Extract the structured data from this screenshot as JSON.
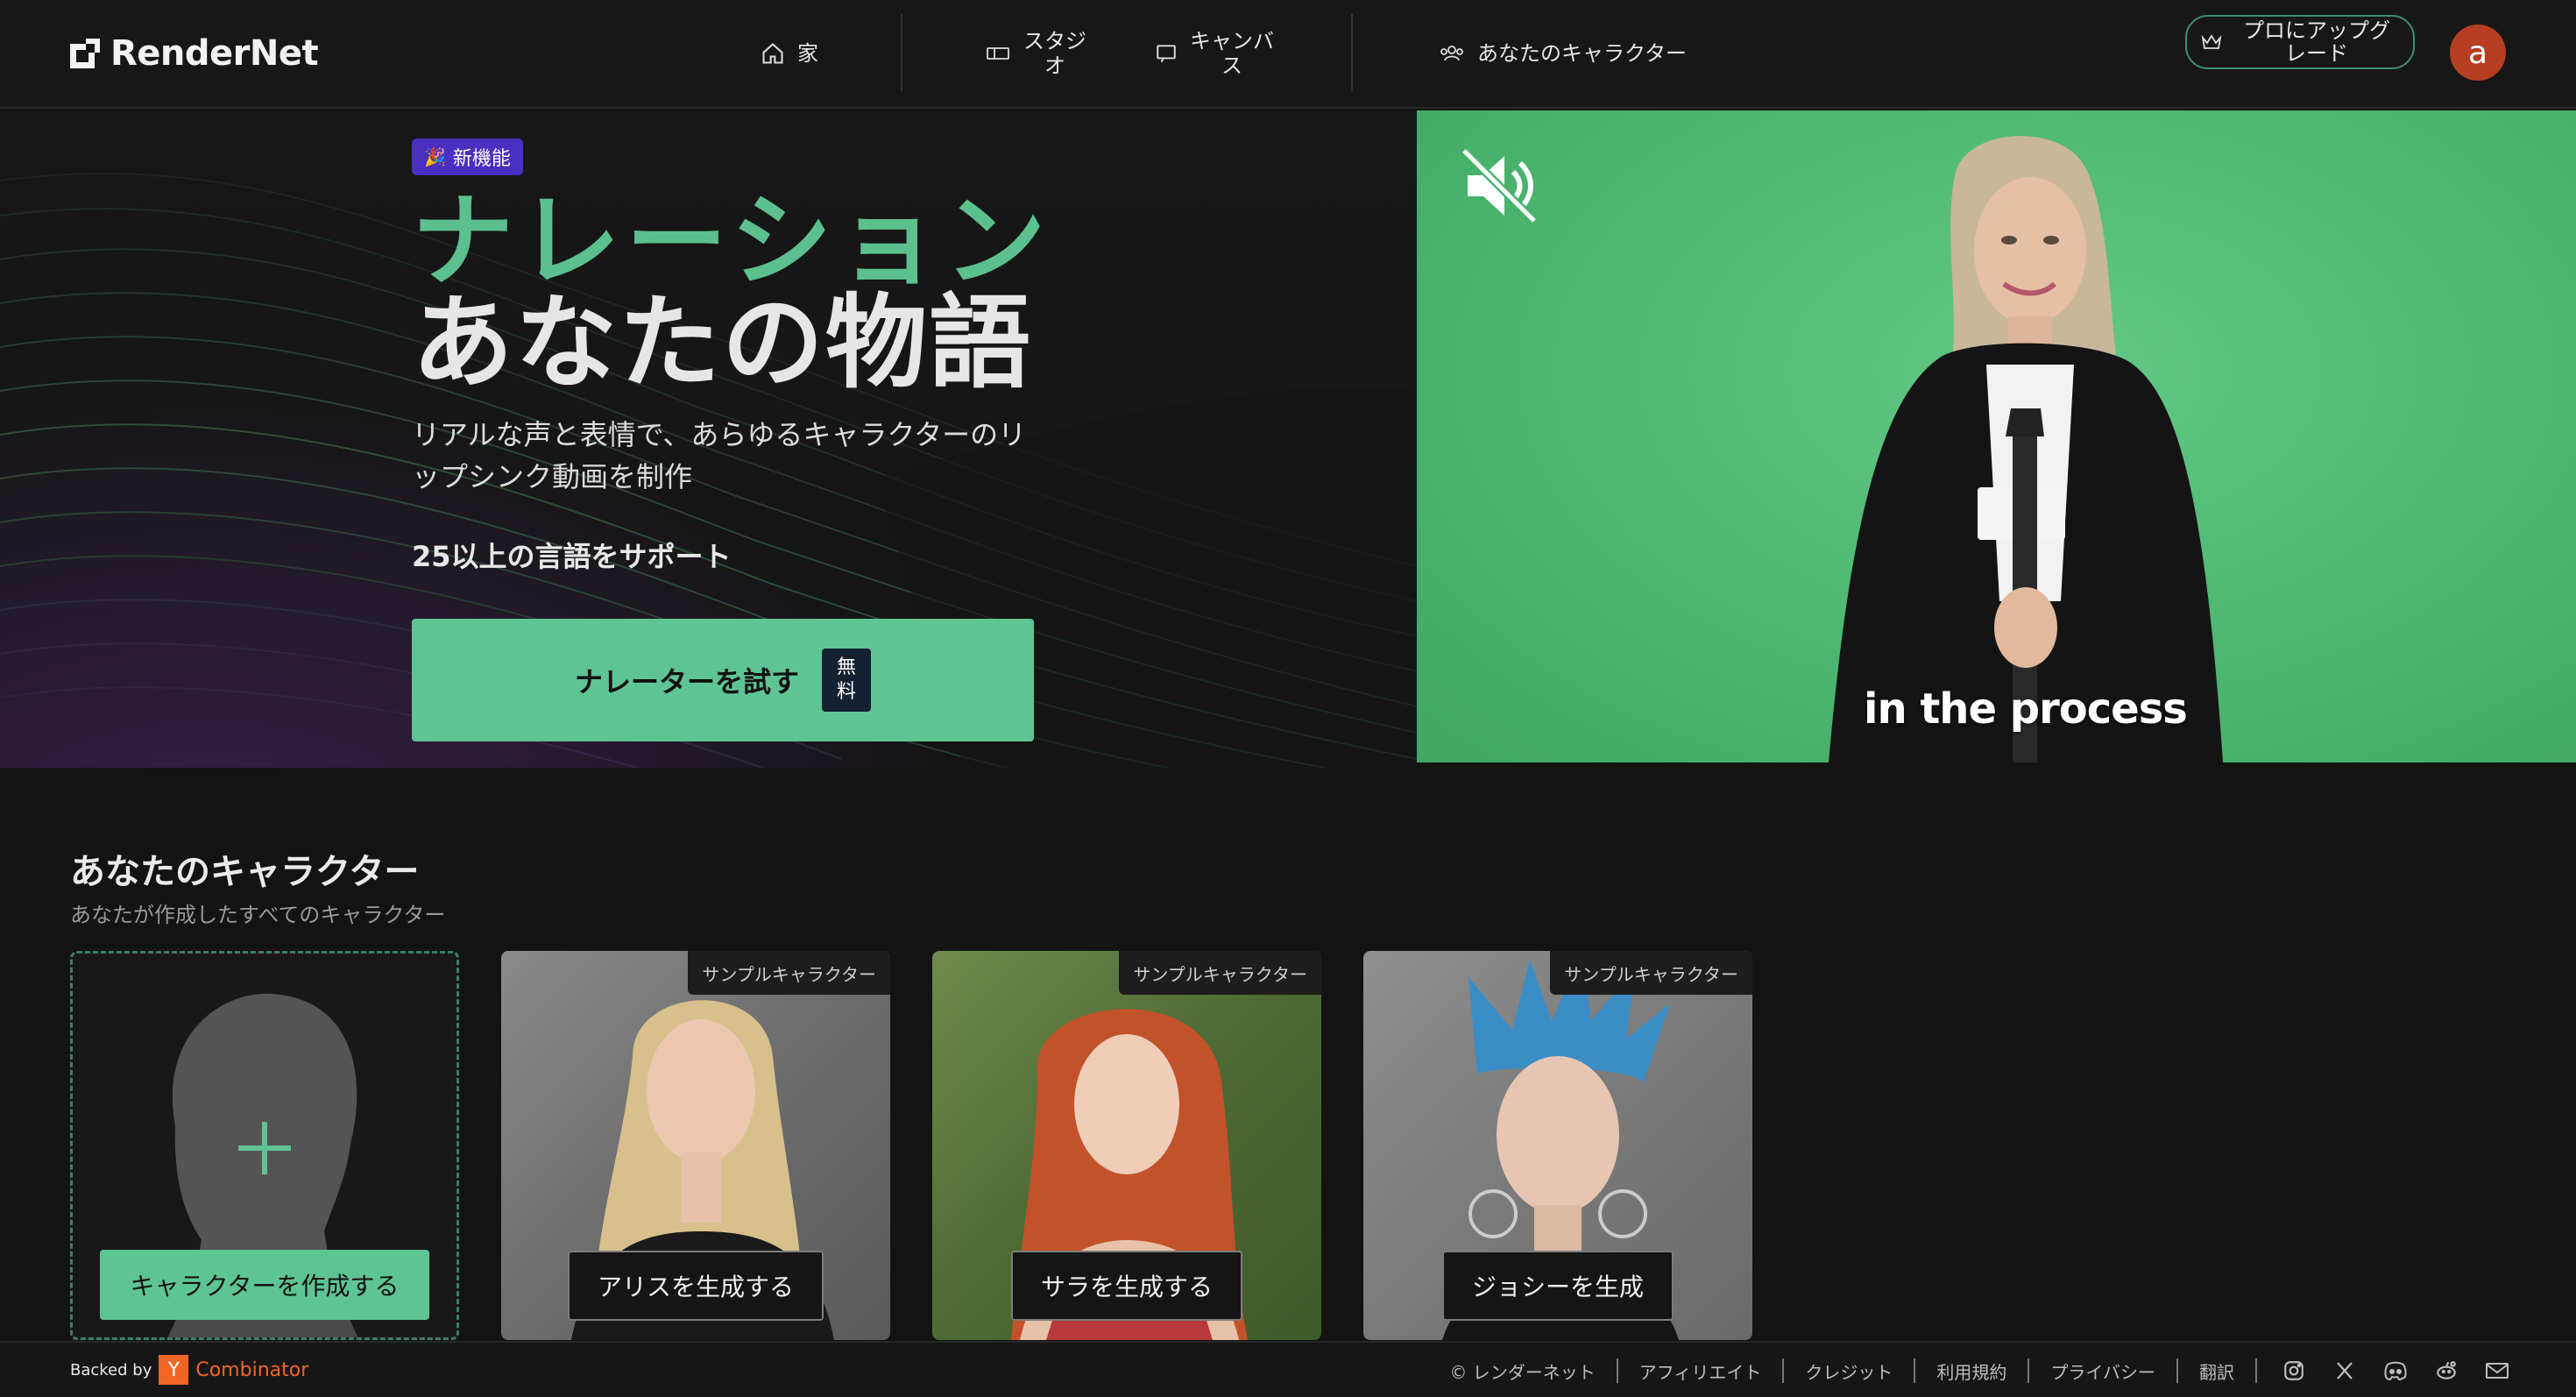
{
  "header": {
    "logo_text": "RenderNet",
    "nav": {
      "home": "家",
      "studio": "スタジ\nオ",
      "canvas": "キャンバ\nス",
      "characters": "あなたのキャラクター"
    },
    "upgrade_label": "プロにアップグレード",
    "avatar_letter": "a"
  },
  "hero": {
    "badge": "新機能",
    "title_line1": "ナレーション",
    "title_line2": "あなたの物語",
    "subtitle": "リアルな声と表情で、あらゆるキャラクターのリップシンク動画を制作",
    "languages": "25以上の言語をサポート",
    "cta_label": "ナレーターを試す",
    "cta_badge": "無料",
    "video_caption": "in the process"
  },
  "characters": {
    "title": "あなたのキャラクター",
    "subtitle": "あなたが作成したすべてのキャラクター",
    "create_label": "キャラクターを作成する",
    "sample_tag": "サンプルキャラクター",
    "samples": [
      {
        "button": "アリスを生成する"
      },
      {
        "button": "サラを生成する"
      },
      {
        "button": "ジョシーを生成"
      }
    ]
  },
  "footer": {
    "backed_by": "Backed by",
    "yc_letter": "Y",
    "yc_name": "Combinator",
    "links": [
      "© レンダーネット",
      "アフィリエイト",
      "クレジット",
      "利用規約",
      "プライバシー",
      "翻訳"
    ]
  },
  "colors": {
    "accent_green": "#5ec493",
    "badge_purple": "#4a2fc2",
    "avatar_red": "#b53d22",
    "yc_orange": "#f26625"
  }
}
